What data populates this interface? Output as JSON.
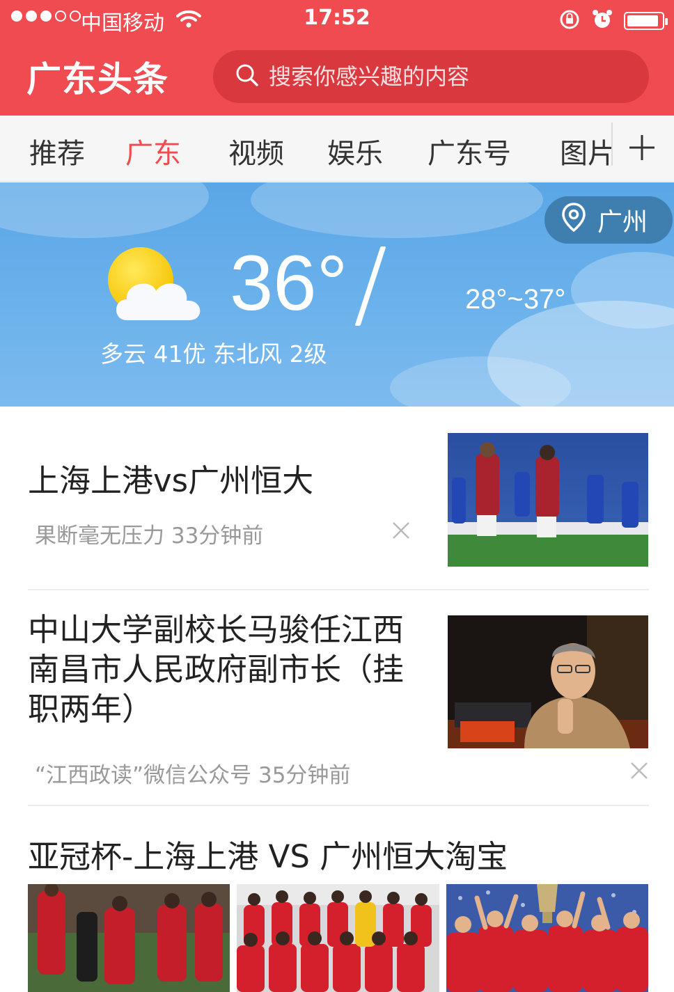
{
  "status": {
    "carrier": "中国移动",
    "time": "17:52",
    "battery_level": 0.85
  },
  "header": {
    "logo": "广东头条",
    "search_placeholder": "搜索你感兴趣的内容"
  },
  "tabs": [
    {
      "label": "推荐",
      "active": false
    },
    {
      "label": "广东",
      "active": true
    },
    {
      "label": "视频",
      "active": false
    },
    {
      "label": "娱乐",
      "active": false
    },
    {
      "label": "广东号",
      "active": false
    },
    {
      "label": "图片",
      "active": false
    }
  ],
  "weather": {
    "location": "广州",
    "temperature": "36°",
    "range": "28°~37°",
    "description": "多云 41优 东北风 2级",
    "icon": "partly-cloudy-icon"
  },
  "news": [
    {
      "title": "上海上港vs广州恒大",
      "meta": "果断毫无压力  33分钟前"
    },
    {
      "title": "中山大学副校长马骏任江西南昌市人民政府副市长（挂职两年）",
      "meta": "“江西政读”微信公众号  35分钟前"
    },
    {
      "title": "亚冠杯-上海上港 VS 广州恒大淘宝"
    }
  ],
  "colors": {
    "brand": "#f04b50",
    "search_bg": "#d8383e",
    "tab_active": "#f04b50",
    "weather_bg": "#6bb2ec"
  }
}
